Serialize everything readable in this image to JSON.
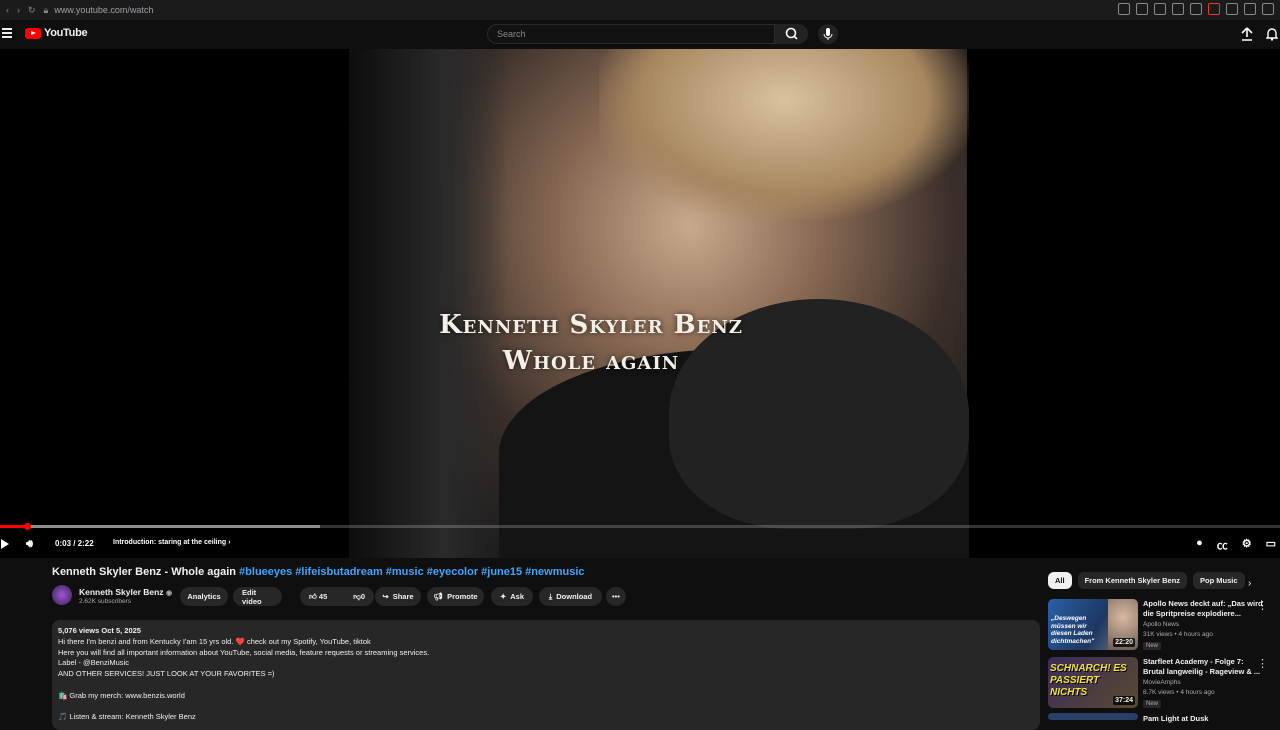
{
  "browser": {
    "url": "www.youtube.com/watch"
  },
  "header": {
    "logo_text": "YouTube",
    "search_placeholder": "Search"
  },
  "player": {
    "overlay_line1": "Kenneth Skyler Benz",
    "overlay_line2": "Whole again",
    "time": "0:03 / 2:22",
    "chapter": "Introduction: staring at the ceiling",
    "progress_fraction": 0.021,
    "buffered_fraction": 0.25
  },
  "video": {
    "title": "Kenneth Skyler Benz - Whole again",
    "tags": "#blueeyes #lifeisbutadream #music #eyecolor #june15 #newmusic",
    "channel": "Kenneth Skyler Benz",
    "subscribers": "2.62K subscribers",
    "actions": {
      "analytics": "Analytics",
      "edit": "Edit video",
      "likes": "45",
      "dislikes": "0",
      "share": "Share",
      "promote": "Promote",
      "ask": "Ask",
      "download": "Download"
    }
  },
  "description": {
    "stats": "5,076 views  Oct 5, 2025",
    "lines": [
      "Hi there I'm benzi and from Kentucky I'am 15 yrs old. ❤️ check out my Spotify, YouTube, tiktok",
      "Here you will find all important information about YouTube, social media, feature requests or streaming services.",
      "Label - @BenziMusic",
      "AND OTHER SERVICES! JUST LOOK AT YOUR FAVORITES =)",
      "",
      "🛍️ Grab my merch: www.benzis.world",
      "",
      "🎵 Listen & stream: Kenneth Skyler Benz"
    ]
  },
  "chips": [
    "All",
    "From Kenneth Skyler Benz",
    "Pop Music"
  ],
  "recommendations": [
    {
      "title": "Apollo News deckt auf: „Das wird die Spritpreise explodiere...",
      "channel": "Apollo News",
      "views": "31K views • 4 hours ago",
      "badge": "New",
      "duration": "22:20",
      "thumb_text": "„Deswegen müssen wir diesen Laden dichtmachen\""
    },
    {
      "title": "Starfleet Academy - Folge 7: Brutal langweilig - Rageview & ...",
      "channel": "MovieAmphs",
      "views": "8.7K views • 4 hours ago",
      "badge": "New",
      "duration": "37:24",
      "thumb_text": "SCHNARCH! ES PASSIERT NICHTS"
    },
    {
      "title": "Pam Light at Dusk",
      "channel": "",
      "views": "",
      "badge": "",
      "duration": "",
      "thumb_text": ""
    }
  ],
  "colors": {
    "accent": "#ff0000",
    "link": "#3ea6ff",
    "background": "#0f0f0f"
  }
}
